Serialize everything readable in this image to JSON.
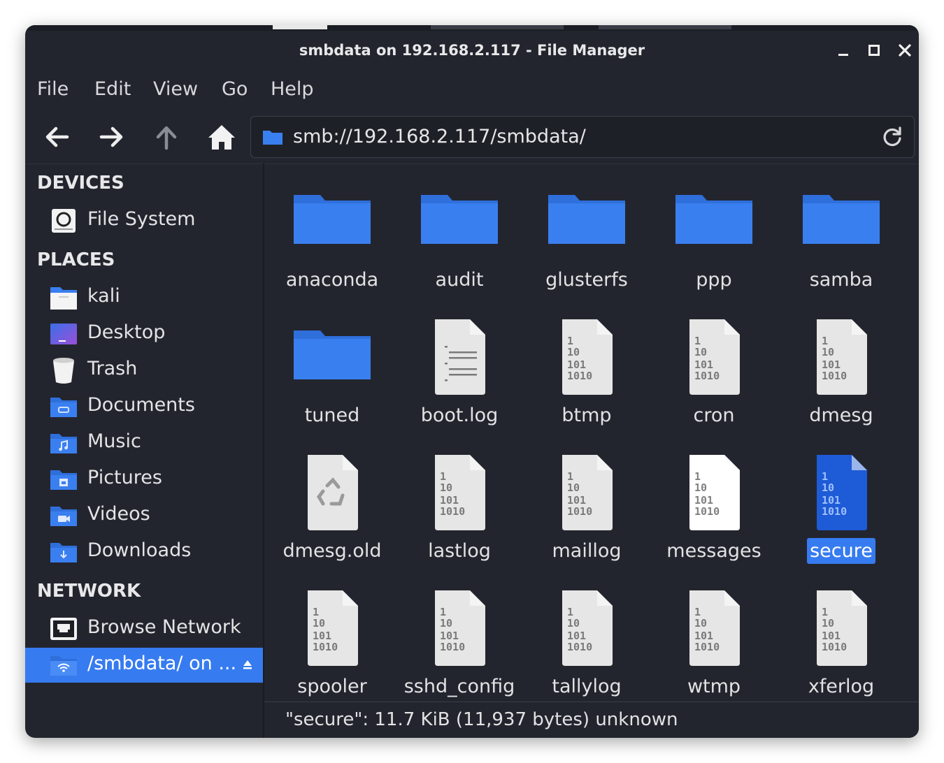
{
  "window": {
    "title": "smbdata on 192.168.2.117 - File Manager"
  },
  "menu": [
    "File",
    "Edit",
    "View",
    "Go",
    "Help"
  ],
  "address": {
    "path": "smb://192.168.2.117/smbdata/"
  },
  "sidebar": {
    "devices_heading": "DEVICES",
    "devices": [
      {
        "label": "File System",
        "icon": "harddisk-icon"
      }
    ],
    "places_heading": "PLACES",
    "places": [
      {
        "label": "kali",
        "icon": "home-folder-icon"
      },
      {
        "label": "Desktop",
        "icon": "desktop-icon"
      },
      {
        "label": "Trash",
        "icon": "trash-icon"
      },
      {
        "label": "Documents",
        "icon": "documents-folder-icon"
      },
      {
        "label": "Music",
        "icon": "music-folder-icon"
      },
      {
        "label": "Pictures",
        "icon": "pictures-folder-icon"
      },
      {
        "label": "Videos",
        "icon": "videos-folder-icon"
      },
      {
        "label": "Downloads",
        "icon": "downloads-folder-icon"
      }
    ],
    "network_heading": "NETWORK",
    "network": [
      {
        "label": "Browse Network",
        "icon": "network-icon"
      },
      {
        "label": "/smbdata/ on ...",
        "icon": "network-share-icon",
        "selected": true
      }
    ]
  },
  "files": [
    {
      "name": "anaconda",
      "type": "folder"
    },
    {
      "name": "audit",
      "type": "folder"
    },
    {
      "name": "glusterfs",
      "type": "folder"
    },
    {
      "name": "ppp",
      "type": "folder"
    },
    {
      "name": "samba",
      "type": "folder"
    },
    {
      "name": "tuned",
      "type": "folder"
    },
    {
      "name": "boot.log",
      "type": "text"
    },
    {
      "name": "btmp",
      "type": "binary"
    },
    {
      "name": "cron",
      "type": "binary"
    },
    {
      "name": "dmesg",
      "type": "binary"
    },
    {
      "name": "dmesg.old",
      "type": "backup"
    },
    {
      "name": "lastlog",
      "type": "binary"
    },
    {
      "name": "maillog",
      "type": "binary"
    },
    {
      "name": "messages",
      "type": "binary-white"
    },
    {
      "name": "secure",
      "type": "binary",
      "selected": true
    },
    {
      "name": "spooler",
      "type": "binary"
    },
    {
      "name": "sshd_config",
      "type": "binary"
    },
    {
      "name": "tallylog",
      "type": "binary"
    },
    {
      "name": "wtmp",
      "type": "binary"
    },
    {
      "name": "xferlog",
      "type": "binary"
    }
  ],
  "status": "\"secure\": 11.7 KiB (11,937 bytes) unknown",
  "colors": {
    "accent": "#367bf0",
    "folder": "#3a7ff0",
    "window_bg": "#23252e"
  }
}
